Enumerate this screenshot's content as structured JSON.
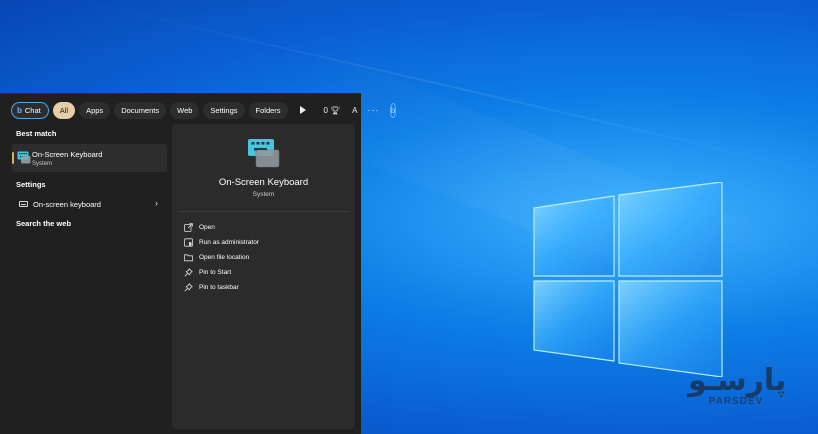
{
  "toolbar": {
    "chips": [
      {
        "label": "Chat"
      },
      {
        "label": "All"
      },
      {
        "label": "Apps"
      },
      {
        "label": "Documents"
      },
      {
        "label": "Web"
      },
      {
        "label": "Settings"
      },
      {
        "label": "Folders"
      }
    ],
    "reward_count": "0",
    "account_initial": "A",
    "more_label": "···",
    "bing_letter": "b"
  },
  "left": {
    "best_match_label": "Best match",
    "best_match": {
      "name": "On-Screen Keyboard",
      "type": "System"
    },
    "settings_label": "Settings",
    "settings_item": "On-screen keyboard",
    "search_web_label": "Search the web"
  },
  "detail": {
    "title": "On-Screen Keyboard",
    "subtitle": "System",
    "actions": [
      {
        "label": "Open",
        "icon": "open-external-icon"
      },
      {
        "label": "Run as administrator",
        "icon": "shield-admin-icon"
      },
      {
        "label": "Open file location",
        "icon": "folder-icon"
      },
      {
        "label": "Pin to Start",
        "icon": "pin-icon"
      },
      {
        "label": "Pin to taskbar",
        "icon": "pin-icon"
      }
    ]
  },
  "watermark": {
    "mark": "پارسـو",
    "text": "PARSDEV"
  },
  "colors": {
    "accent": "#e1b15b",
    "chat_border": "#4ea7e8",
    "active_chip": "#e6cfa7",
    "panel_bg": "#202020",
    "detail_bg": "#2b2b2b"
  }
}
